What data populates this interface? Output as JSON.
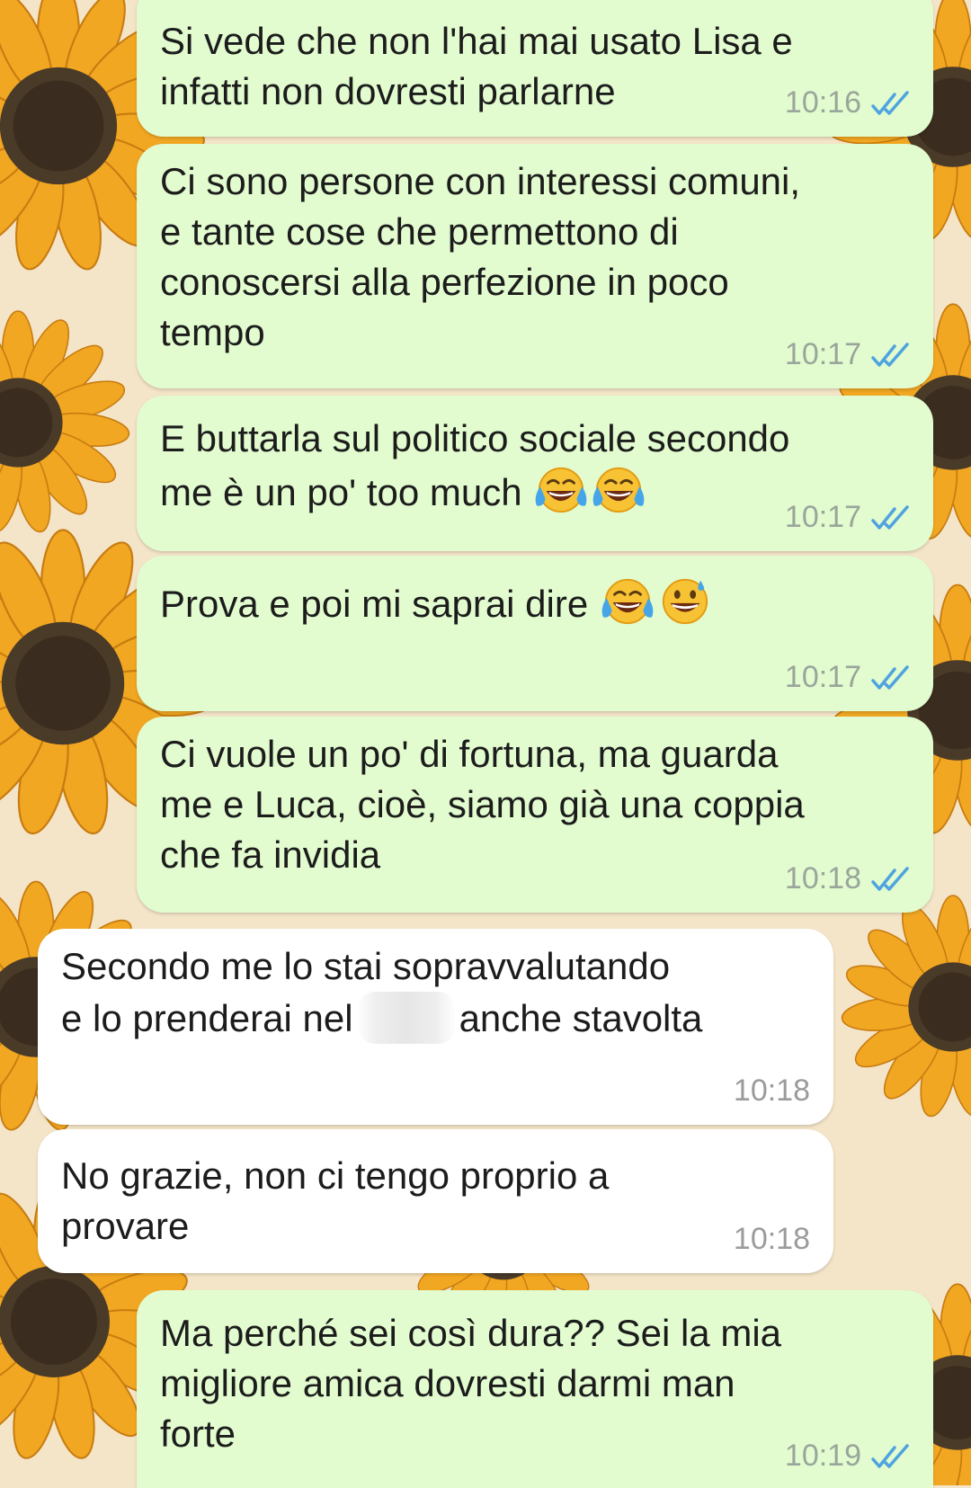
{
  "colors": {
    "outgoing_bubble": "#e2fccf",
    "incoming_bubble": "#ffffff",
    "read_ticks": "#4fa3e0",
    "wallpaper_bg": "#f4e4c8",
    "sunflower_petal": "#f1a722",
    "sunflower_center": "#4a3a28"
  },
  "messages": [
    {
      "direction": "out",
      "text": "Si vede che non l'hai mai usato Lisa e\ninfatti non dovresti parlarne",
      "time": "10:16",
      "status": "read"
    },
    {
      "direction": "out",
      "text": "Ci sono persone con interessi comuni,\ne tante cose che permettono di\nconoscersi alla perfezione in poco\ntempo",
      "time": "10:17",
      "status": "read"
    },
    {
      "direction": "out",
      "text_line1": "E buttarla sul politico sociale secondo",
      "text_line2": "me è un po' too much",
      "emojis": [
        "face-with-tears-of-joy",
        "face-with-tears-of-joy"
      ],
      "time": "10:17",
      "status": "read"
    },
    {
      "direction": "out",
      "text": "Prova e poi mi saprai dire",
      "emojis": [
        "face-with-tears-of-joy",
        "grinning-face-with-sweat"
      ],
      "time": "10:17",
      "status": "read"
    },
    {
      "direction": "out",
      "text": "Ci vuole un po' di fortuna, ma guarda\nme e Luca, cioè, siamo già una coppia\nche fa invidia",
      "time": "10:18",
      "status": "read"
    },
    {
      "direction": "in",
      "text_line1": "Secondo me lo stai sopravvalutando",
      "text_before": "e lo prenderai nel",
      "text_after": "anche stavolta",
      "time": "10:18"
    },
    {
      "direction": "in",
      "text": "No grazie, non ci tengo proprio a\nprovare",
      "time": "10:18"
    },
    {
      "direction": "out",
      "text": "Ma perché sei così dura?? Sei la mia\nmigliore amica dovresti darmi man\nforte",
      "time": "10:19",
      "status": "read"
    }
  ]
}
